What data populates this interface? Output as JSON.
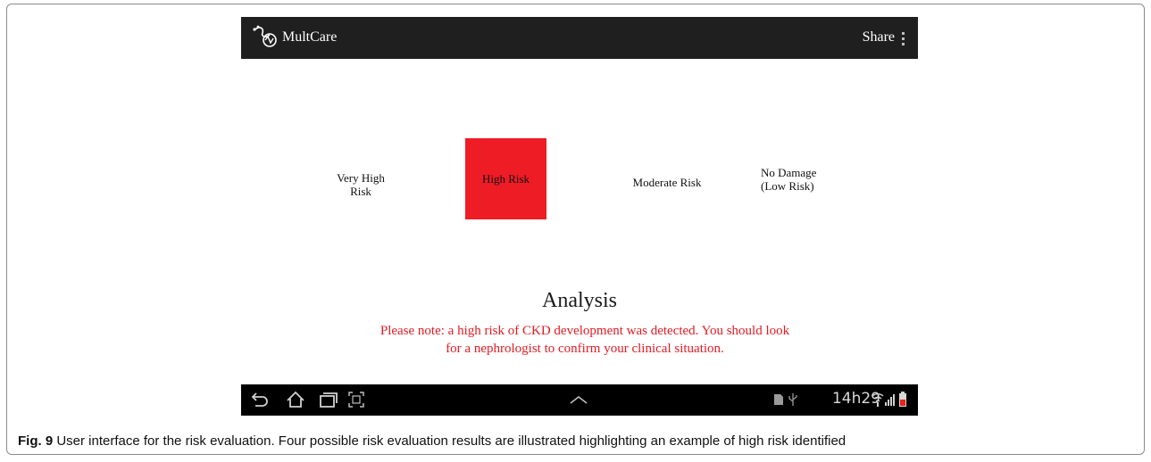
{
  "app": {
    "title": "MultCare",
    "share_label": "Share"
  },
  "risk_levels": [
    {
      "label": "Very High\nRisk",
      "selected": false
    },
    {
      "label": "High Risk",
      "selected": true,
      "color": "#ee1c25"
    },
    {
      "label": "Moderate Risk",
      "selected": false
    },
    {
      "label": "No Damage\n(Low Risk)",
      "selected": false
    }
  ],
  "analysis": {
    "title": "Analysis",
    "note": "Please note: a high risk of CKD development was detected. You should look for a nephrologist to confirm your clinical situation.",
    "note_color": "#e31b23"
  },
  "status_bar": {
    "time": "14h29",
    "icons": [
      "back-icon",
      "home-icon",
      "recent-apps-icon",
      "screenshot-icon",
      "chevron-up-icon",
      "sim-icon",
      "usb-icon",
      "wifi-icon",
      "signal-icon",
      "battery-icon"
    ]
  },
  "caption": {
    "label": "Fig. 9",
    "text": " User interface for the risk evaluation. Four possible risk evaluation results are illustrated highlighting an example of high risk identified"
  }
}
